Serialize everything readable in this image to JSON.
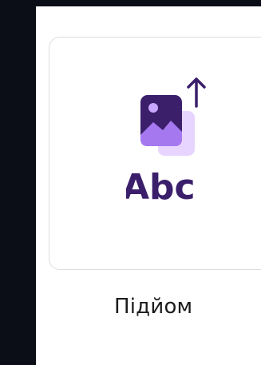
{
  "tile": {
    "caption": "Підйом",
    "icon_label": "Abc",
    "icon_name": "upload-image-text-icon"
  },
  "colors": {
    "background": "#0b0e17",
    "panel": "#ffffff",
    "accent_dark": "#3b1f6b",
    "accent_light": "#e8d5ff",
    "accent_mid": "#a678f0"
  }
}
